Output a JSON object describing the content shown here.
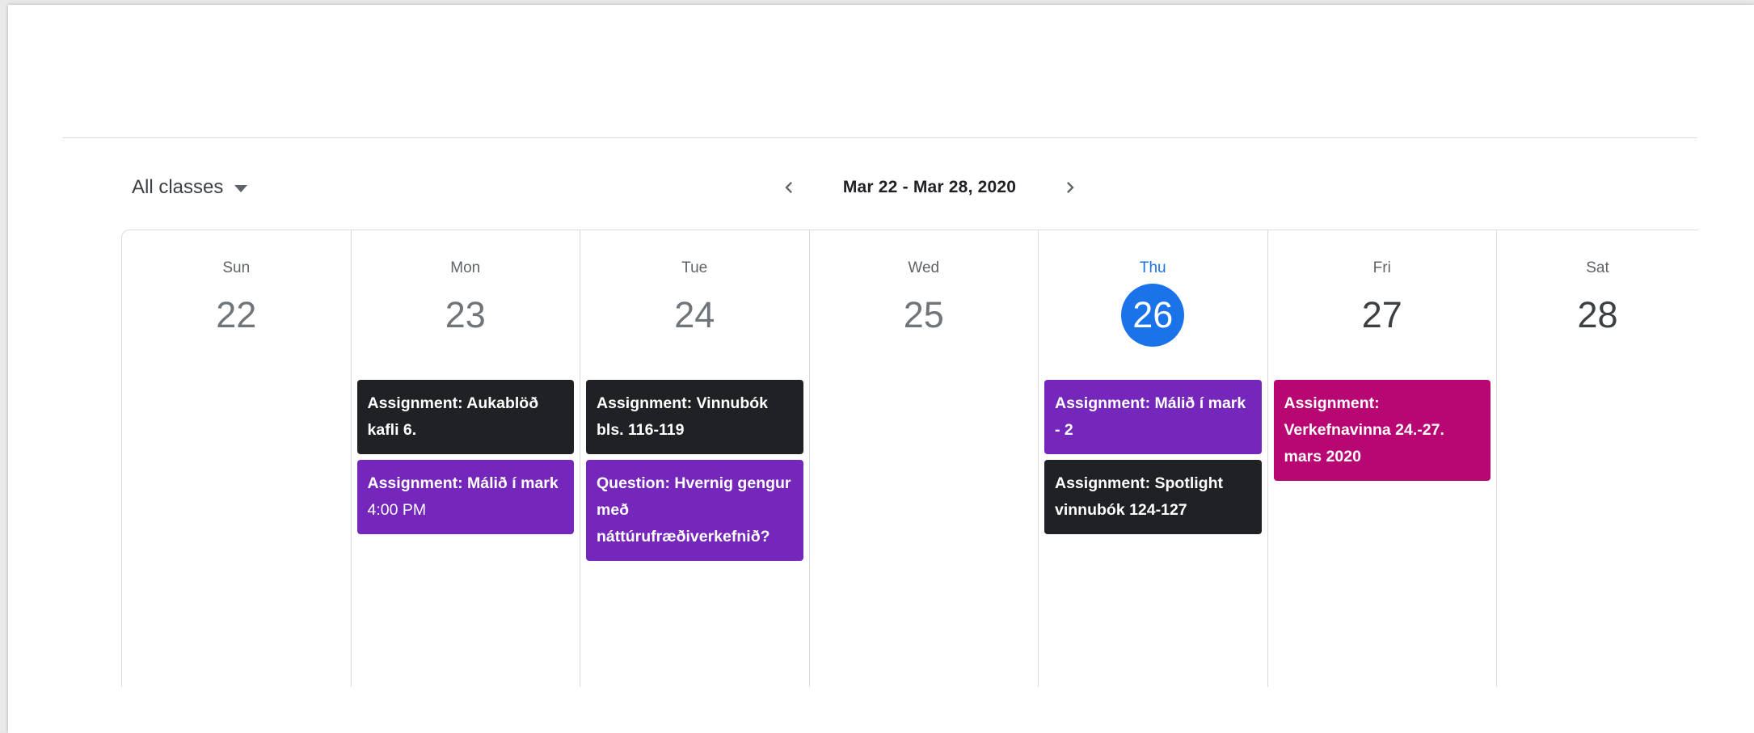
{
  "toolbar": {
    "class_filter": "All classes",
    "range": "Mar 22 - Mar 28, 2020"
  },
  "icons": {
    "filter_caret": "caret-down-icon",
    "prev": "chevron-left-icon",
    "next": "chevron-right-icon"
  },
  "colors": {
    "today": "#1a73e8",
    "event_dark": "#202124",
    "event_purple": "#7627bb",
    "event_magenta": "#b80672"
  },
  "days": [
    {
      "dow": "Sun",
      "date": "22"
    },
    {
      "dow": "Mon",
      "date": "23"
    },
    {
      "dow": "Tue",
      "date": "24"
    },
    {
      "dow": "Wed",
      "date": "25"
    },
    {
      "dow": "Thu",
      "date": "26"
    },
    {
      "dow": "Fri",
      "date": "27"
    },
    {
      "dow": "Sat",
      "date": "28"
    }
  ],
  "events": {
    "mon": [
      {
        "title": "Assignment: Aukablöð kafli 6."
      },
      {
        "title": "Assignment: Málið í mark",
        "time": "4:00 PM"
      }
    ],
    "tue": [
      {
        "title": "Assignment: Vinnubók bls. 116-119"
      },
      {
        "title": "Question: Hvernig gengur með náttúrufræðiverkefnið?"
      }
    ],
    "thu": [
      {
        "title": "Assignment: Málið í mark - 2"
      },
      {
        "title": "Assignment: Spotlight vinnubók 124-127"
      }
    ],
    "fri": [
      {
        "title": "Assignment: Verkefnavinna 24.-27. mars 2020"
      }
    ]
  }
}
